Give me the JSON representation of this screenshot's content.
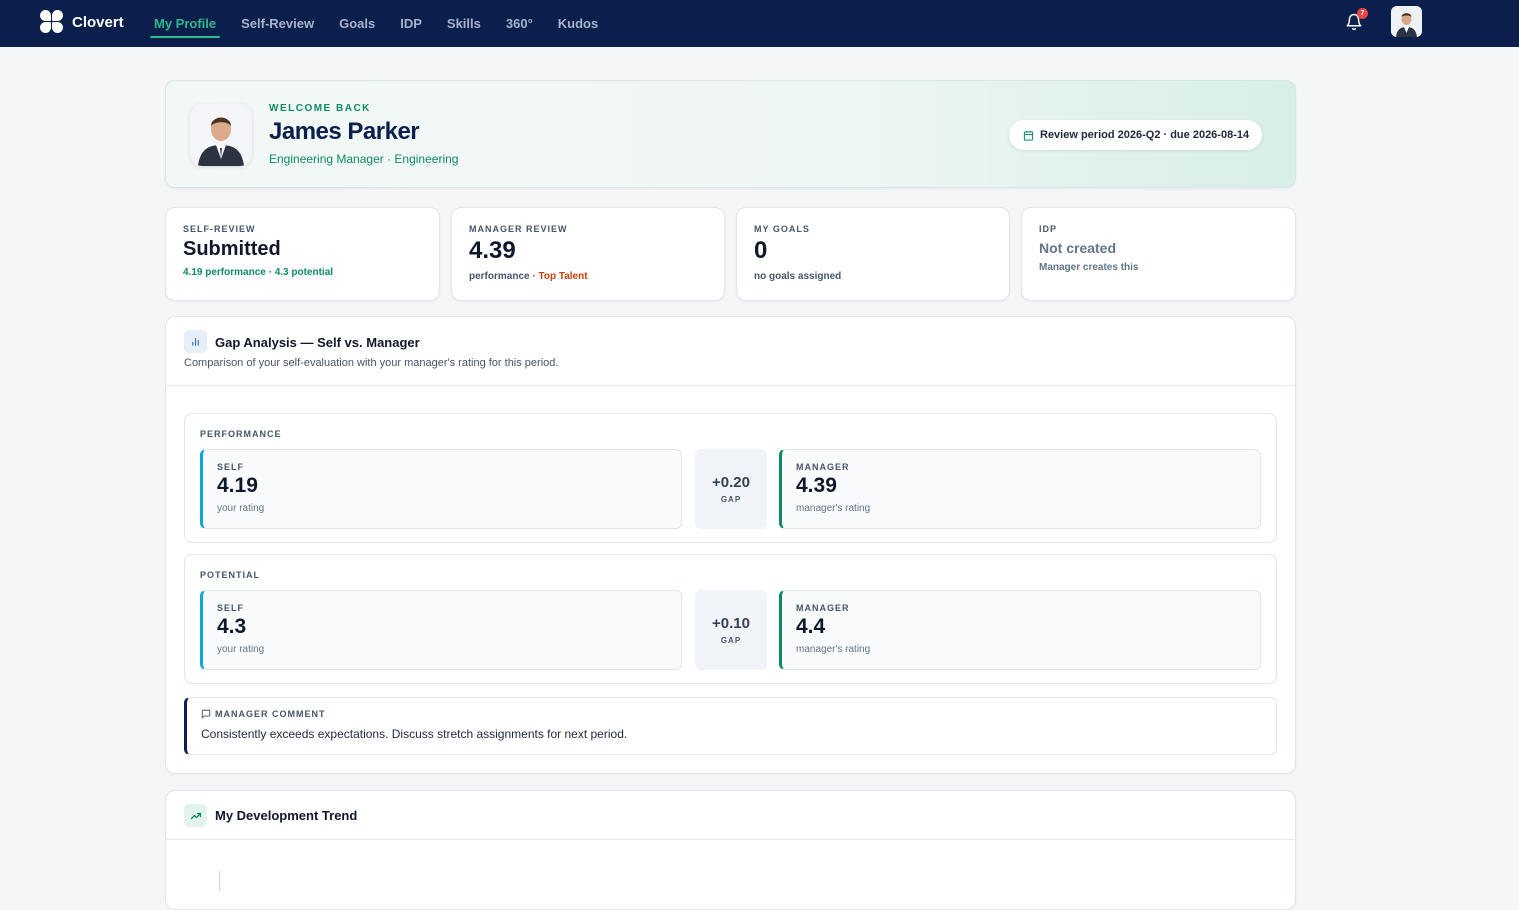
{
  "app": {
    "brand": "Clovert",
    "notifications_count": "7"
  },
  "nav": {
    "tabs": [
      {
        "label": "My Profile",
        "active": true
      },
      {
        "label": "Self-Review"
      },
      {
        "label": "Goals"
      },
      {
        "label": "IDP"
      },
      {
        "label": "Skills"
      },
      {
        "label": "360°"
      },
      {
        "label": "Kudos"
      }
    ]
  },
  "hero": {
    "eyebrow": "WELCOME BACK",
    "name": "James Parker",
    "role": "Engineering Manager · Engineering",
    "period": "Review period 2026-Q2 · due 2026-08-14"
  },
  "stats": {
    "self_review": {
      "label": "SELF-REVIEW",
      "value": "Submitted",
      "sub": "4.19 performance · 4.3 potential"
    },
    "manager_review": {
      "label": "MANAGER REVIEW",
      "value": "4.39",
      "sub_prefix": "performance · ",
      "sub_highlight": "Top Talent"
    },
    "goals": {
      "label": "MY GOALS",
      "value": "0",
      "sub": "no goals assigned"
    },
    "idp": {
      "label": "IDP",
      "value": "Not created",
      "sub": "Manager creates this"
    }
  },
  "gap": {
    "title": "Gap Analysis — Self vs. Manager",
    "description": "Comparison of your self-evaluation with your manager's rating for this period.",
    "groups": [
      {
        "label": "PERFORMANCE",
        "self": {
          "label": "SELF",
          "value": "4.19",
          "sub": "your rating"
        },
        "gap": {
          "value": "+0.20",
          "label": "GAP"
        },
        "manager": {
          "label": "MANAGER",
          "value": "4.39",
          "sub": "manager's rating"
        }
      },
      {
        "label": "POTENTIAL",
        "self": {
          "label": "SELF",
          "value": "4.3",
          "sub": "your rating"
        },
        "gap": {
          "value": "+0.10",
          "label": "GAP"
        },
        "manager": {
          "label": "MANAGER",
          "value": "4.4",
          "sub": "manager's rating"
        }
      }
    ],
    "comment": {
      "label": "MANAGER COMMENT",
      "text": "Consistently exceeds expectations. Discuss stretch assignments for next period."
    }
  },
  "trend": {
    "title": "My Development Trend"
  },
  "colors": {
    "nav_bg": "#0b1f4d",
    "accent_green": "#0f8a62",
    "self_blue": "#0ea5d9",
    "top_talent_orange": "#c2410c"
  }
}
